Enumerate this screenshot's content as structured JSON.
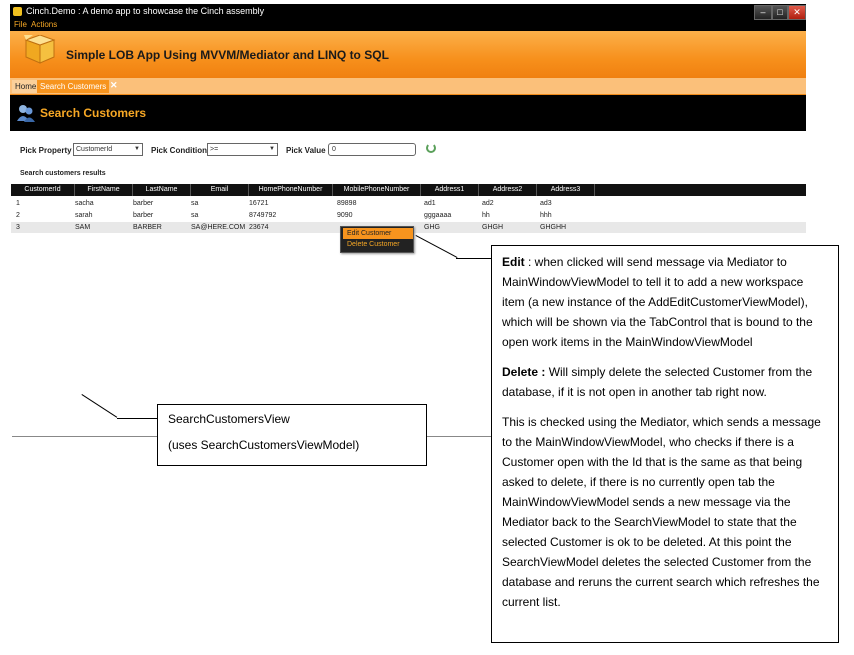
{
  "window": {
    "title": "Cinch.Demo : A demo app to showcase the Cinch assembly",
    "minimize": "–",
    "maximize": "□",
    "close": "✕"
  },
  "menu": {
    "items": [
      "File",
      "Actions"
    ]
  },
  "banner": {
    "title": "Simple LOB App Using MVVM/Mediator and LINQ to SQL"
  },
  "tabs": [
    {
      "label": "Home"
    },
    {
      "label": "Search Customers"
    }
  ],
  "tab_close": "✕",
  "header": {
    "title": "Search Customers"
  },
  "filter": {
    "property_label": "Pick Property",
    "property_value": "CustomerId",
    "condition_label": "Pick Condition",
    "condition_value": ">=",
    "value_label": "Pick Value",
    "value_value": "0"
  },
  "grid": {
    "title": "Search customers results",
    "columns": [
      "CustomerId",
      "FirstName",
      "LastName",
      "Email",
      "HomePhoneNumber",
      "MobilePhoneNumber",
      "Address1",
      "Address2",
      "Address3"
    ],
    "rows": [
      [
        "1",
        "sacha",
        "barber",
        "sa",
        "16721",
        "89898",
        "ad1",
        "ad2",
        "ad3"
      ],
      [
        "2",
        "sarah",
        "barber",
        "sa",
        "8749792",
        "9090",
        "gggaaaa",
        "hh",
        "hhh"
      ],
      [
        "3",
        "SAM",
        "BARBER",
        "SA@HERE.COM",
        "23674",
        "",
        "GHG",
        "GHGH",
        "GHGHH"
      ]
    ]
  },
  "context_menu": {
    "edit": "Edit Customer",
    "delete": "Delete Customer"
  },
  "annotation": {
    "edit_title": "Edit",
    "edit_text": " : when clicked will send message via Mediator to MainWindowViewModel  to tell it to add a new workspace item (a new instance of the AddEditCustomerViewModel),  which will be shown via the TabControl that is bound to the open work items in the MainWindowViewModel",
    "delete_title": "Delete :",
    "delete_text": " Will simply delete the selected Customer from the database, if it is not open in another tab right now.",
    "check_text": "This is checked using the Mediator, which sends a message to the MainWindowViewModel,  who checks if there is a Customer open with the Id that is the same as that being asked to delete, if there is no currently open tab the MainWindowViewModel  sends a new message via the Mediator back to the SearchViewModel  to state that the selected Customer is ok to be deleted. At this point the SearchViewModel  deletes the selected Customer from the database and reruns the current search which refreshes the current list.",
    "view_name": "SearchCustomersView",
    "view_model": "(uses SearchCustomersViewModel)"
  },
  "colors": {
    "accent": "#f7941e",
    "header_bg": "#000000",
    "header_text": "#f7a825"
  }
}
